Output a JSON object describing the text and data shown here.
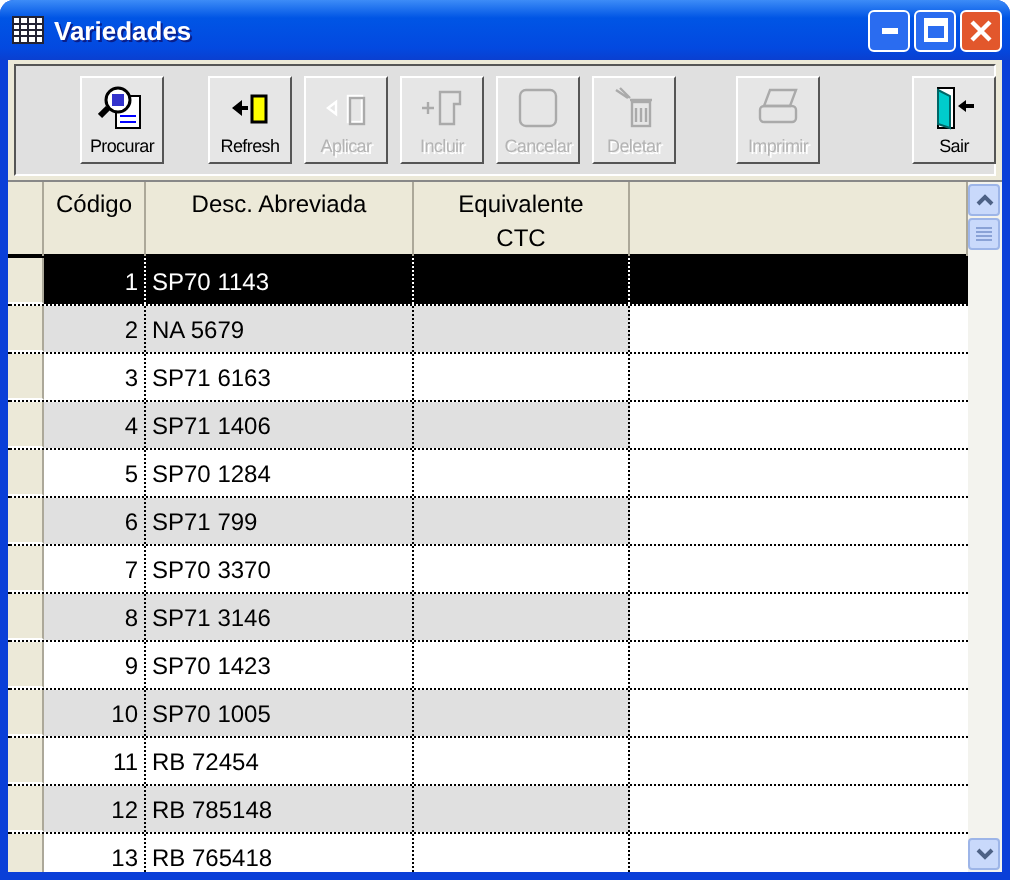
{
  "window": {
    "title": "Variedades"
  },
  "toolbar": [
    {
      "label": "Procurar",
      "kind": "search",
      "enabled": true
    },
    {
      "label": "Refresh",
      "kind": "refresh",
      "enabled": true
    },
    {
      "label": "Aplicar",
      "kind": "apply",
      "enabled": false
    },
    {
      "label": "Incluir",
      "kind": "add",
      "enabled": false
    },
    {
      "label": "Cancelar",
      "kind": "cancel",
      "enabled": false
    },
    {
      "label": "Deletar",
      "kind": "delete",
      "enabled": false
    },
    {
      "label": "Imprimir",
      "kind": "print",
      "enabled": false
    },
    {
      "label": "Sair",
      "kind": "exit",
      "enabled": true
    }
  ],
  "table": {
    "columns": [
      "Código",
      "Desc. Abreviada",
      "Equivalente CTC"
    ],
    "rows": [
      {
        "codigo": "1",
        "desc": "SP70 1143",
        "selected": true
      },
      {
        "codigo": "2",
        "desc": "NA 5679",
        "selected": false
      },
      {
        "codigo": "3",
        "desc": "SP71 6163",
        "selected": false
      },
      {
        "codigo": "4",
        "desc": "SP71 1406",
        "selected": false
      },
      {
        "codigo": "5",
        "desc": "SP70 1284",
        "selected": false
      },
      {
        "codigo": "6",
        "desc": "SP71 799",
        "selected": false
      },
      {
        "codigo": "7",
        "desc": "SP70 3370",
        "selected": false
      },
      {
        "codigo": "8",
        "desc": "SP71 3146",
        "selected": false
      },
      {
        "codigo": "9",
        "desc": "SP70 1423",
        "selected": false
      },
      {
        "codigo": "10",
        "desc": "SP70 1005",
        "selected": false
      },
      {
        "codigo": "11",
        "desc": "RB 72454",
        "selected": false
      },
      {
        "codigo": "12",
        "desc": "RB 785148",
        "selected": false
      },
      {
        "codigo": "13",
        "desc": "RB 765418",
        "selected": false
      }
    ]
  }
}
